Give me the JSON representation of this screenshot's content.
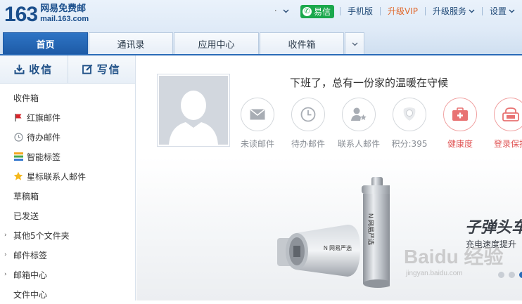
{
  "header": {
    "logo_number": "163",
    "logo_name": "网易免费邮",
    "logo_domain": "mail.163.com",
    "yixin_label": "易信",
    "mobile_label": "手机版",
    "vip_label": "升级VIP",
    "service_label": "升级服务",
    "settings_label": "设置"
  },
  "tabs": [
    {
      "label": "首页",
      "active": true
    },
    {
      "label": "通讯录",
      "active": false
    },
    {
      "label": "应用中心",
      "active": false
    },
    {
      "label": "收件箱",
      "active": false
    }
  ],
  "sidebar": {
    "receive_label": "收信",
    "write_label": "写信",
    "folders": [
      {
        "label": "收件箱",
        "icon": "none"
      },
      {
        "label": "红旗邮件",
        "icon": "red-flag-icon"
      },
      {
        "label": "待办邮件",
        "icon": "clock-icon"
      },
      {
        "label": "智能标签",
        "icon": "smart-tag-icon"
      },
      {
        "label": "星标联系人邮件",
        "icon": "star-icon"
      },
      {
        "label": "草稿箱",
        "icon": "none"
      },
      {
        "label": "已发送",
        "icon": "none"
      },
      {
        "label": "其他5个文件夹",
        "icon": "caret"
      },
      {
        "label": "邮件标签",
        "icon": "caret"
      },
      {
        "label": "邮箱中心",
        "icon": "caret"
      },
      {
        "label": "文件中心",
        "icon": "none"
      }
    ]
  },
  "main": {
    "greeting": "下班了，总有一份家的温暖在守候",
    "shortcuts": [
      {
        "label": "未读邮件",
        "icon": "envelope-icon"
      },
      {
        "label": "待办邮件",
        "icon": "clock-icon"
      },
      {
        "label": "联系人邮件",
        "icon": "contact-star-icon"
      },
      {
        "label": "积分:395",
        "icon": "points-icon"
      },
      {
        "label": "健康度",
        "icon": "medical-kit-icon"
      },
      {
        "label": "登录保护",
        "icon": "login-protect-icon"
      }
    ],
    "banner": {
      "title": "子弹头车",
      "subtitle": "充电速度提升",
      "watermark": "Baidu 经验",
      "watermark_sub": "jingyan.baidu.com",
      "slide_count": 3,
      "active_slide": 2
    }
  },
  "colors": {
    "brand_blue": "#1d5aa6",
    "vip_orange": "#e06a2f",
    "yixin_green": "#1aa84c",
    "alert_red": "#e05454"
  }
}
